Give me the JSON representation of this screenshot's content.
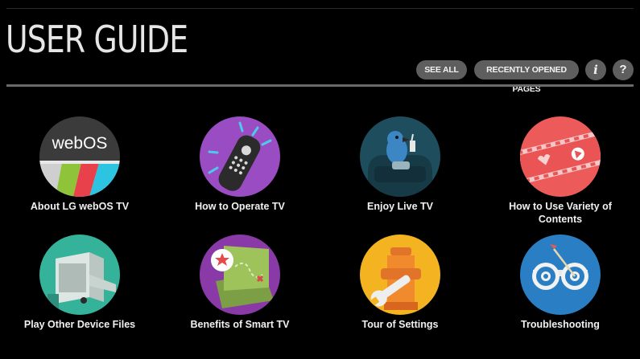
{
  "header": {
    "title": "USER GUIDE",
    "see_all": "SEE ALL",
    "recently_opened": "RECENTLY OPENED PAGES",
    "info_glyph": "i",
    "help_glyph": "?"
  },
  "tiles": [
    {
      "label": "About LG webOS TV",
      "icon": "webos-logo-icon",
      "logo_text": "webOS"
    },
    {
      "label": "How to Operate TV",
      "icon": "remote-control-icon"
    },
    {
      "label": "Enjoy Live TV",
      "icon": "bird-on-sofa-icon"
    },
    {
      "label": "How to Use Variety of Contents",
      "icon": "film-strip-icon"
    },
    {
      "label": "Play Other Device Files",
      "icon": "connected-device-icon"
    },
    {
      "label": "Benefits of Smart TV",
      "icon": "treasure-map-icon"
    },
    {
      "label": "Tour of Settings",
      "icon": "wrench-hydrant-icon"
    },
    {
      "label": "Troubleshooting",
      "icon": "target-binoculars-icon"
    }
  ],
  "colors": {
    "background": "#000000",
    "pill": "#5e5e5e",
    "divider": "#6a6a6a"
  }
}
